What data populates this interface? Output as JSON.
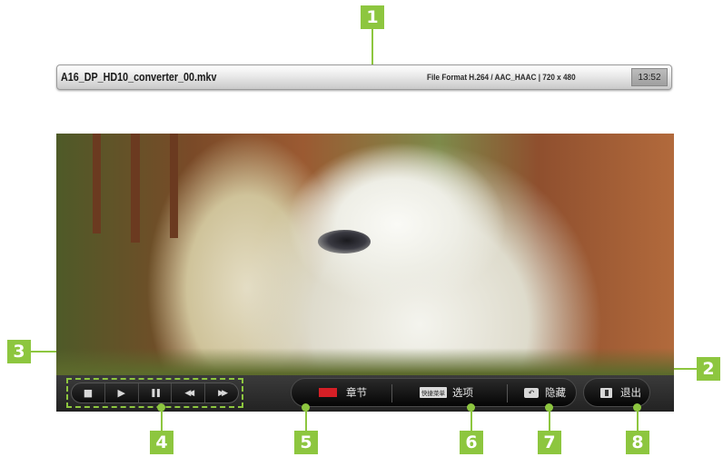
{
  "info_bar": {
    "file_name": "A16_DP_HD10_converter_00.mkv",
    "file_format": "File Format H.264 / AAC_HAAC | 720 x 480",
    "time": "13:52"
  },
  "playback_controls": {
    "buttons": [
      {
        "name": "stop",
        "glyph": "■"
      },
      {
        "name": "play",
        "glyph": "▶"
      },
      {
        "name": "pause",
        "glyph": "❚❚"
      },
      {
        "name": "rewind",
        "glyph": "◀◀"
      },
      {
        "name": "fast-forward",
        "glyph": "▶▶"
      }
    ]
  },
  "option_bar": {
    "chapter_label": "章节",
    "quick_menu_key": "快捷菜单",
    "options_label": "选项",
    "hide_label": "隐藏",
    "exit_label": "退出"
  },
  "callouts": {
    "c1": "1",
    "c2": "2",
    "c3": "3",
    "c4": "4",
    "c5": "5",
    "c6": "6",
    "c7": "7",
    "c8": "8"
  },
  "colors": {
    "callout": "#8dc63f",
    "red_key": "#d51f26",
    "control_bar": "#2a2a2a"
  },
  "icons": [
    "stop-icon",
    "play-icon",
    "pause-icon",
    "rewind-icon",
    "fast-forward-icon",
    "red-key-icon",
    "back-key-icon",
    "exit-key-icon"
  ]
}
